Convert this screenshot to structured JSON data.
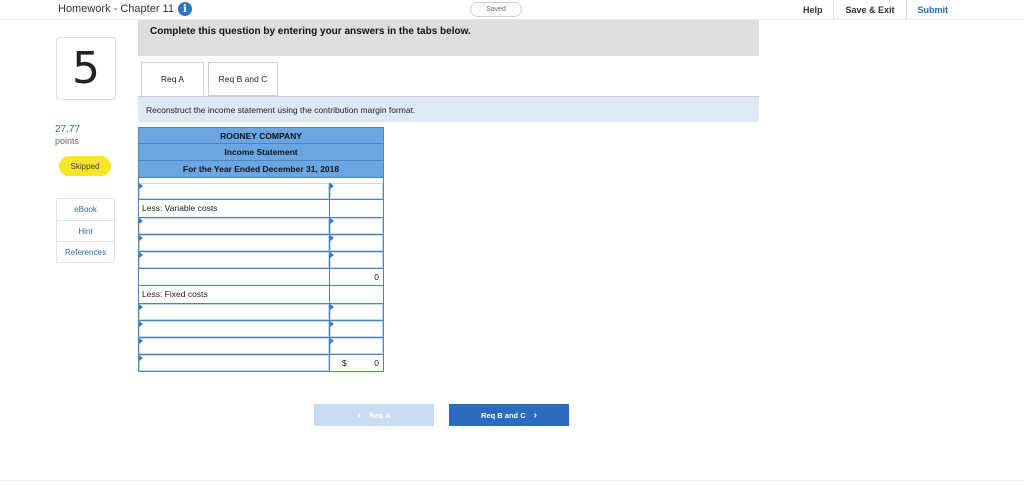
{
  "header": {
    "title": "Homework - Chapter 11",
    "saved": "Saved",
    "help": "Help",
    "save_exit": "Save & Exit",
    "submit": "Submit"
  },
  "question": {
    "number": "5",
    "points_value": "27.77",
    "points_label": "points",
    "status": "Skipped"
  },
  "resources": [
    "eBook",
    "Hint",
    "References"
  ],
  "main": {
    "instruction": "Complete this question by entering your answers in the tabs below.",
    "tabs": [
      "Req A",
      "Req B and C"
    ],
    "prompt": "Reconstruct the income statement using the contribution margin format."
  },
  "statement": {
    "company": "ROONEY COMPANY",
    "title": "Income Statement",
    "period": "For the Year Ended December 31, 2018",
    "less_variable": "Less: Variable costs",
    "subtotal_value": "0",
    "less_fixed": "Less: Fixed costs",
    "dollar_sign": "$",
    "total_value": "0"
  },
  "nav": {
    "prev": "Req A",
    "next": "Req B and C"
  },
  "colors": {
    "accent": "#2b6cc0",
    "header_fill": "#6aa5e4",
    "skipped": "#f5e629"
  }
}
